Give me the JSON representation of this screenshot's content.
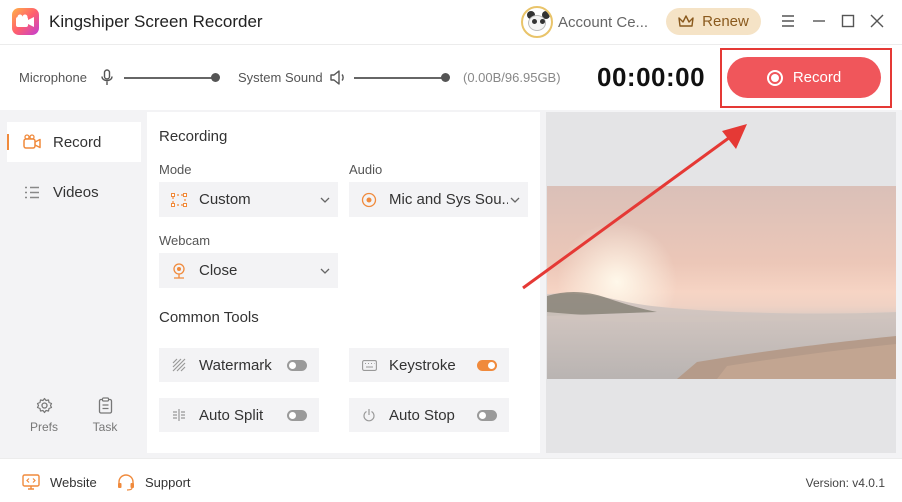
{
  "app": {
    "title": "Kingshiper Screen Recorder",
    "account_label": "Account Ce...",
    "renew_label": "Renew"
  },
  "controls": {
    "microphone_label": "Microphone",
    "system_sound_label": "System Sound",
    "storage": "(0.00B/96.95GB)",
    "timer": "00:00:00",
    "record_label": "Record"
  },
  "sidebar": {
    "items": [
      {
        "label": "Record"
      },
      {
        "label": "Videos"
      }
    ],
    "prefs_label": "Prefs",
    "task_label": "Task"
  },
  "recording": {
    "title": "Recording",
    "mode_label": "Mode",
    "mode_value": "Custom",
    "audio_label": "Audio",
    "audio_value": "Mic and Sys Sou...",
    "webcam_label": "Webcam",
    "webcam_value": "Close"
  },
  "tools": {
    "title": "Common Tools",
    "watermark": {
      "label": "Watermark",
      "on": false
    },
    "keystroke": {
      "label": "Keystroke",
      "on": true
    },
    "auto_split": {
      "label": "Auto Split",
      "on": false
    },
    "auto_stop": {
      "label": "Auto Stop",
      "on": false
    }
  },
  "footer": {
    "website_label": "Website",
    "support_label": "Support",
    "version": "Version: v4.0.1"
  },
  "colors": {
    "accent": "#f08a3c",
    "record": "#f0565b",
    "highlight": "#e53935"
  }
}
